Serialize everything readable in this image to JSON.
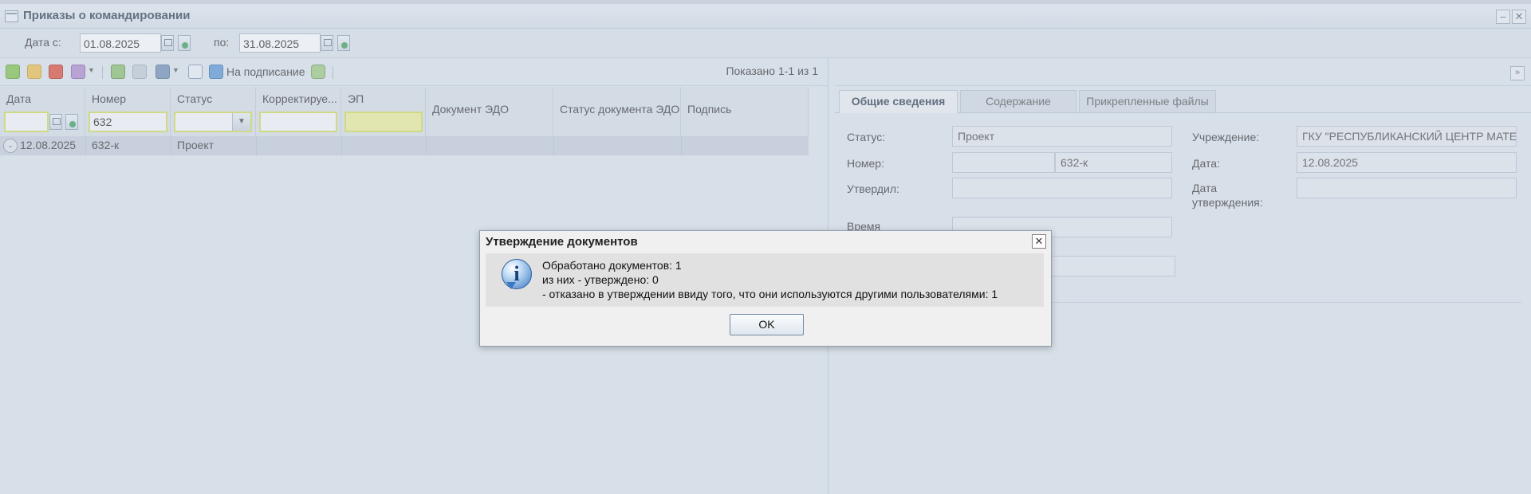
{
  "window": {
    "title": "Приказы о командировании"
  },
  "filter": {
    "date_from_label": "Дата с:",
    "date_from": "01.08.2025",
    "date_to_label": "по:",
    "date_to": "31.08.2025"
  },
  "toolbar": {
    "sign_label": "На подписание",
    "shown_text": "Показано 1-1 из 1"
  },
  "grid": {
    "columns": [
      "Дата",
      "Номер",
      "Статус",
      "Корректируе...",
      "ЭП",
      "Документ ЭДО",
      "Статус документа ЭДО",
      "Подпись"
    ],
    "number_filter": "632",
    "rows": [
      {
        "date": "12.08.2025",
        "number": "632-к",
        "status": "Проект"
      }
    ]
  },
  "details": {
    "tabs": [
      "Общие сведения",
      "Содержание",
      "Прикрепленные файлы"
    ],
    "status_label": "Статус:",
    "status_value": "Проект",
    "number_label": "Номер:",
    "number_value": "632-к",
    "approved_by_label": "Утвердил:",
    "time_label": "Время",
    "institution_label": "Учреждение:",
    "institution_value": "ГКУ \"РЕСПУБЛИКАНСКИЙ ЦЕНТР МАТЕ",
    "date_label": "Дата:",
    "date_value": "12.08.2025",
    "approval_date_label_1": "Дата",
    "approval_date_label_2": "утверждения:"
  },
  "dialog": {
    "title": "Утверждение документов",
    "line1": "Обработано документов: 1",
    "line2": "из них - утверждено: 0",
    "line3": "- отказано в утверждении ввиду того, что они используются другими пользователями: 1",
    "ok_label": "OK"
  }
}
